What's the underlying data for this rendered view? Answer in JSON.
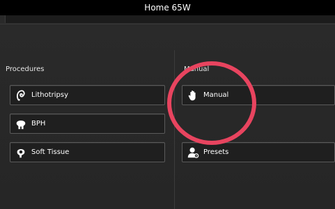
{
  "window": {
    "title": "Home 65W"
  },
  "procedures": {
    "heading": "Procedures",
    "items": [
      {
        "label": "Lithotripsy",
        "icon": "lithotripsy-icon"
      },
      {
        "label": "BPH",
        "icon": "bph-icon"
      },
      {
        "label": "Soft Tissue",
        "icon": "soft-tissue-icon"
      }
    ]
  },
  "manual": {
    "heading": "Manual",
    "items": [
      {
        "label": "Manual",
        "icon": "hand-icon"
      },
      {
        "label": "Presets",
        "icon": "presets-icon"
      }
    ]
  },
  "colors": {
    "highlight_ring": "#e8445f",
    "background": "#262626",
    "titlebar": "#000000"
  }
}
